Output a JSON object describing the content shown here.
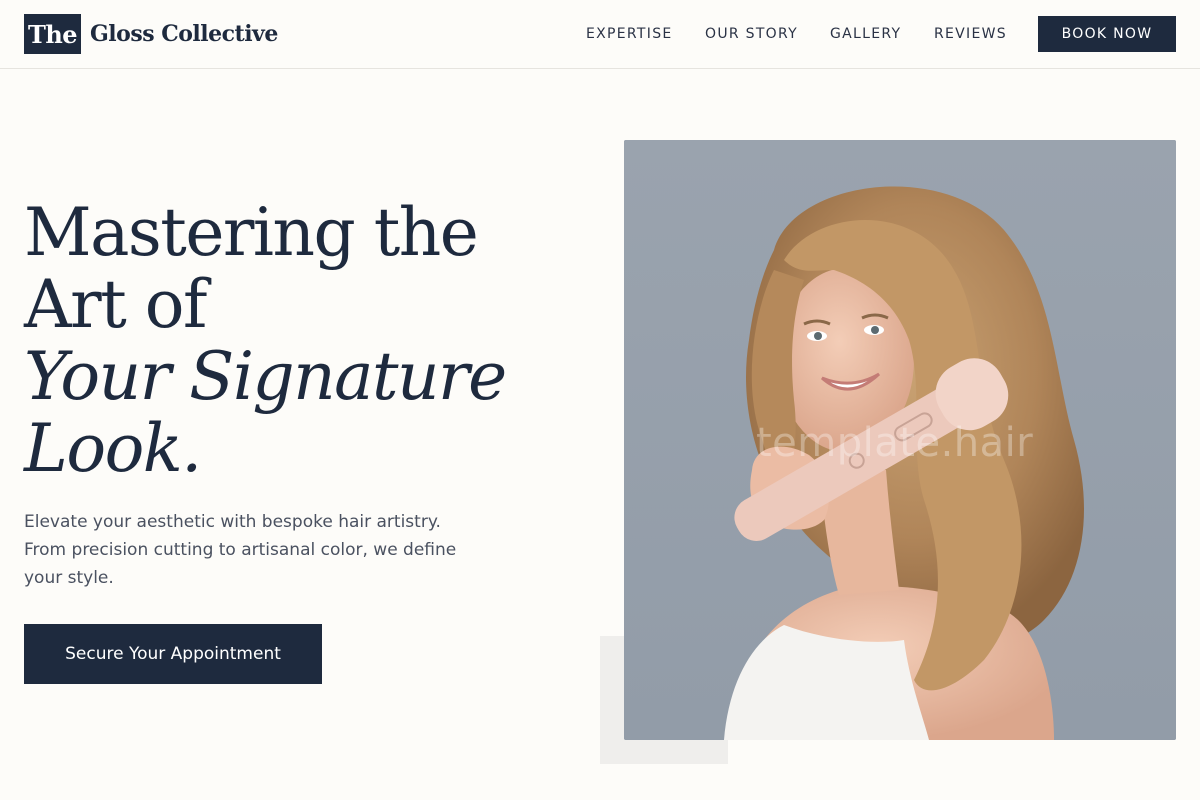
{
  "brand": {
    "badge": "The",
    "name": "Gloss Collective",
    "color": "#1e2a3e"
  },
  "nav": {
    "items": [
      {
        "label": "EXPERTISE"
      },
      {
        "label": "OUR STORY"
      },
      {
        "label": "GALLERY"
      },
      {
        "label": "REVIEWS"
      }
    ],
    "cta_label": "BOOK NOW"
  },
  "hero": {
    "title_line1": "Mastering the",
    "title_line2": "Art of",
    "title_line3": "Your Signature",
    "title_line4": "Look.",
    "subtitle": "Elevate your aesthetic with bespoke hair artistry. From precision cutting to artisanal color, we define your style.",
    "cta_label": "Secure Your Appointment",
    "image_watermark": "template.hair",
    "image_alt": "Woman with long wavy blonde hair holding a pink automatic curling iron"
  },
  "colors": {
    "navy": "#1e2a3e",
    "background": "#fdfcf9",
    "image_backdrop": "#96a0ab"
  }
}
